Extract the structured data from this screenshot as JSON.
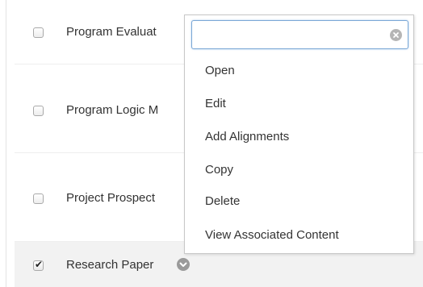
{
  "list": {
    "items": [
      {
        "label": "Program Evaluat",
        "checked": false
      },
      {
        "label": "Program Logic M",
        "checked": false
      },
      {
        "label": "Project Prospect",
        "checked": false
      },
      {
        "label": "Research Paper",
        "checked": true
      }
    ]
  },
  "context_menu": {
    "search_value": "",
    "search_placeholder": "",
    "items": [
      {
        "label": "Open"
      },
      {
        "label": "Edit"
      },
      {
        "label": "Add Alignments"
      },
      {
        "label": "Copy"
      },
      {
        "label": "Delete"
      },
      {
        "label": "View Associated Content"
      }
    ]
  },
  "icons": {
    "clear": "clear-circle-icon",
    "menu_toggle": "chevron-down-circle-icon",
    "checkmark": "checkmark-icon"
  },
  "colors": {
    "search_focus_border": "#7aa7d6",
    "selected_row_bg": "#f2f2f2",
    "text": "#333333",
    "chevron_button": "#9a9a9a"
  }
}
